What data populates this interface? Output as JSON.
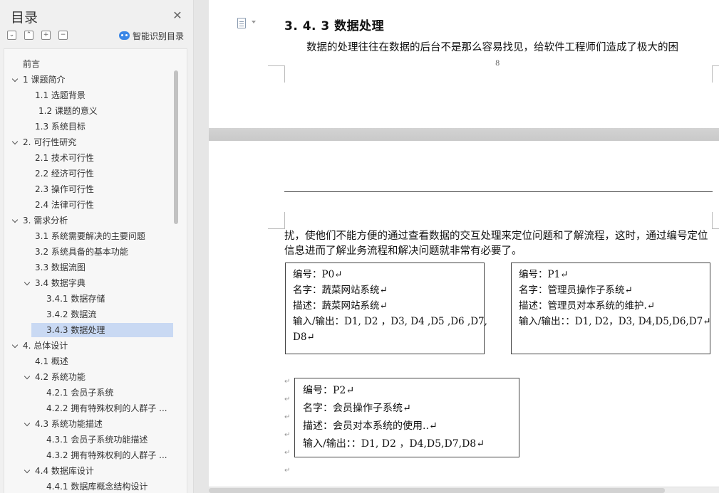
{
  "sidebar": {
    "title": "目录",
    "smart_toc_label": "智能识别目录",
    "toc": [
      {
        "text": "前言"
      },
      {
        "text": "1   课题简介",
        "expanded": true
      },
      {
        "text": "1.1  选题背景"
      },
      {
        "text": "1.2  课题的意义"
      },
      {
        "text": "1.3  系统目标"
      },
      {
        "text": "2.   可行性研究",
        "expanded": true
      },
      {
        "text": "2.1    技术可行性"
      },
      {
        "text": "2.2    经济可行性"
      },
      {
        "text": "2.3    操作可行性"
      },
      {
        "text": "2.4    法律可行性"
      },
      {
        "text": "3.   需求分析",
        "expanded": true
      },
      {
        "text": "3.1    系统需要解决的主要问题"
      },
      {
        "text": "3.2    系统具备的基本功能"
      },
      {
        "text": "3.3    数据流图"
      },
      {
        "text": "3.4    数据字典",
        "expanded": true
      },
      {
        "text": "3.4.1    数据存储"
      },
      {
        "text": "3.4.2    数据流"
      },
      {
        "text": "3.4.3    数据处理",
        "selected": true
      },
      {
        "text": "4.   总体设计",
        "expanded": true
      },
      {
        "text": "4.1    概述"
      },
      {
        "text": "4.2    系统功能",
        "expanded": true
      },
      {
        "text": "4.2.1    会员子系统"
      },
      {
        "text": "4.2.2    拥有特殊权利的人群子 ..."
      },
      {
        "text": "4.3    系统功能描述",
        "expanded": true
      },
      {
        "text": "4.3.1    会员子系统功能描述"
      },
      {
        "text": "4.3.2    拥有特殊权利的人群子 ..."
      },
      {
        "text": "4.4  数据库设计",
        "expanded": true
      },
      {
        "text": "4.4.1    数据库概念结构设计"
      }
    ]
  },
  "document": {
    "heading": "3. 4. 3   数据处理",
    "heading_para": "数据的处理往往在数据的后台不是那么容易找见，给软件工程师们造成了极大的困",
    "page_number": "8",
    "continuation": "扰，使他们不能方便的通过查看数据的交互处理来定位问题和了解流程，这时，通过编号定位信息进而了解业务流程和解决问题就非常有必要了。",
    "para_mark": "↵",
    "boxes": [
      {
        "lines": [
          "编号：P0↵",
          "名字：蔬菜网站系统↵",
          "描述：蔬菜网站系统↵",
          "输入/输出：D1, D2  ，D3, D4 ,D5 ,D6 ,D7,",
          "D8↵"
        ]
      },
      {
        "lines": [
          "编号：P1↵",
          "名字：管理员操作子系统↵",
          "描述：管理员对本系统的维护.↵",
          "输入/输出：：D1, D2，D3, D4,D5,D6,D7↵"
        ]
      },
      {
        "lines": [
          "编号：P2↵",
          "名字：会员操作子系统↵",
          "描述：会员对本系统的使用..↵",
          "输入/输出：：D1, D2  ，D4,D5,D7,D8↵"
        ]
      }
    ]
  }
}
